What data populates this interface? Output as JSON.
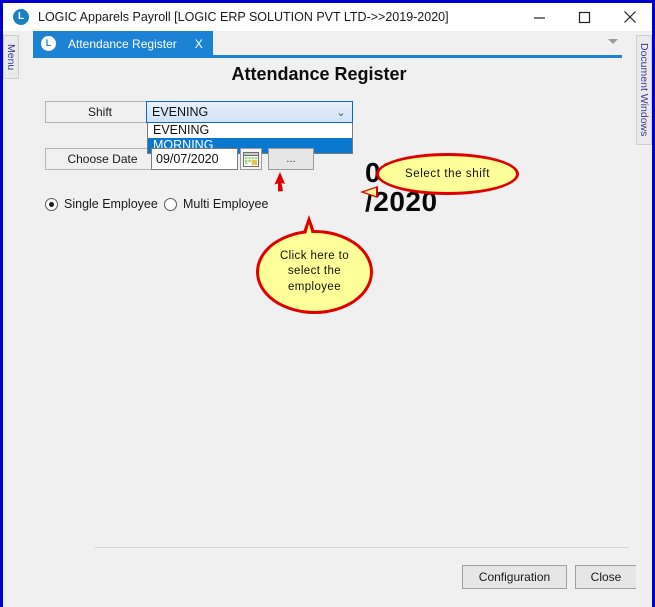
{
  "window": {
    "title": "LOGIC Apparels Payroll  [LOGIC ERP SOLUTION PVT LTD->>2019-2020]",
    "logo_letter": "L",
    "minimize_icon": "minimize-icon",
    "maximize_icon": "maximize-icon",
    "close_icon": "close-icon"
  },
  "rails": {
    "menu_label": "Menu",
    "document_windows_label": "Document Windows"
  },
  "tab": {
    "label": "Attendance Register",
    "logo_letter": "L",
    "close_glyph": "X",
    "overflow_icon": "chevron-down-icon"
  },
  "form": {
    "title": "Attendance Register",
    "shift": {
      "label": "Shift",
      "value": "EVENING",
      "arrow_icon": "chevron-down-icon",
      "options": [
        {
          "label": "EVENING",
          "selected": false
        },
        {
          "label": "MORNING",
          "selected": true
        }
      ]
    },
    "date": {
      "label": "Choose Date",
      "value": "09/07/2020",
      "calendar_icon": "calendar-icon",
      "browse_label": "...",
      "annotation": "09/07\n/2020"
    },
    "employee_mode": {
      "single_label": "Single Employee",
      "single_checked": true,
      "multi_label": "Multi Employee",
      "multi_checked": false
    }
  },
  "callouts": {
    "shift": "Select  the  shift",
    "employee": "Click  here  to select  the employee"
  },
  "footer": {
    "configuration_label": "Configuration",
    "close_label": "Close"
  },
  "colors": {
    "window_border": "#0000cc",
    "tab_active": "#1c82d4",
    "dropdown_highlight": "#0b78d0",
    "callout_fill": "#ffff99",
    "callout_stroke": "#e10000",
    "client_bg": "#f0f0f0"
  }
}
